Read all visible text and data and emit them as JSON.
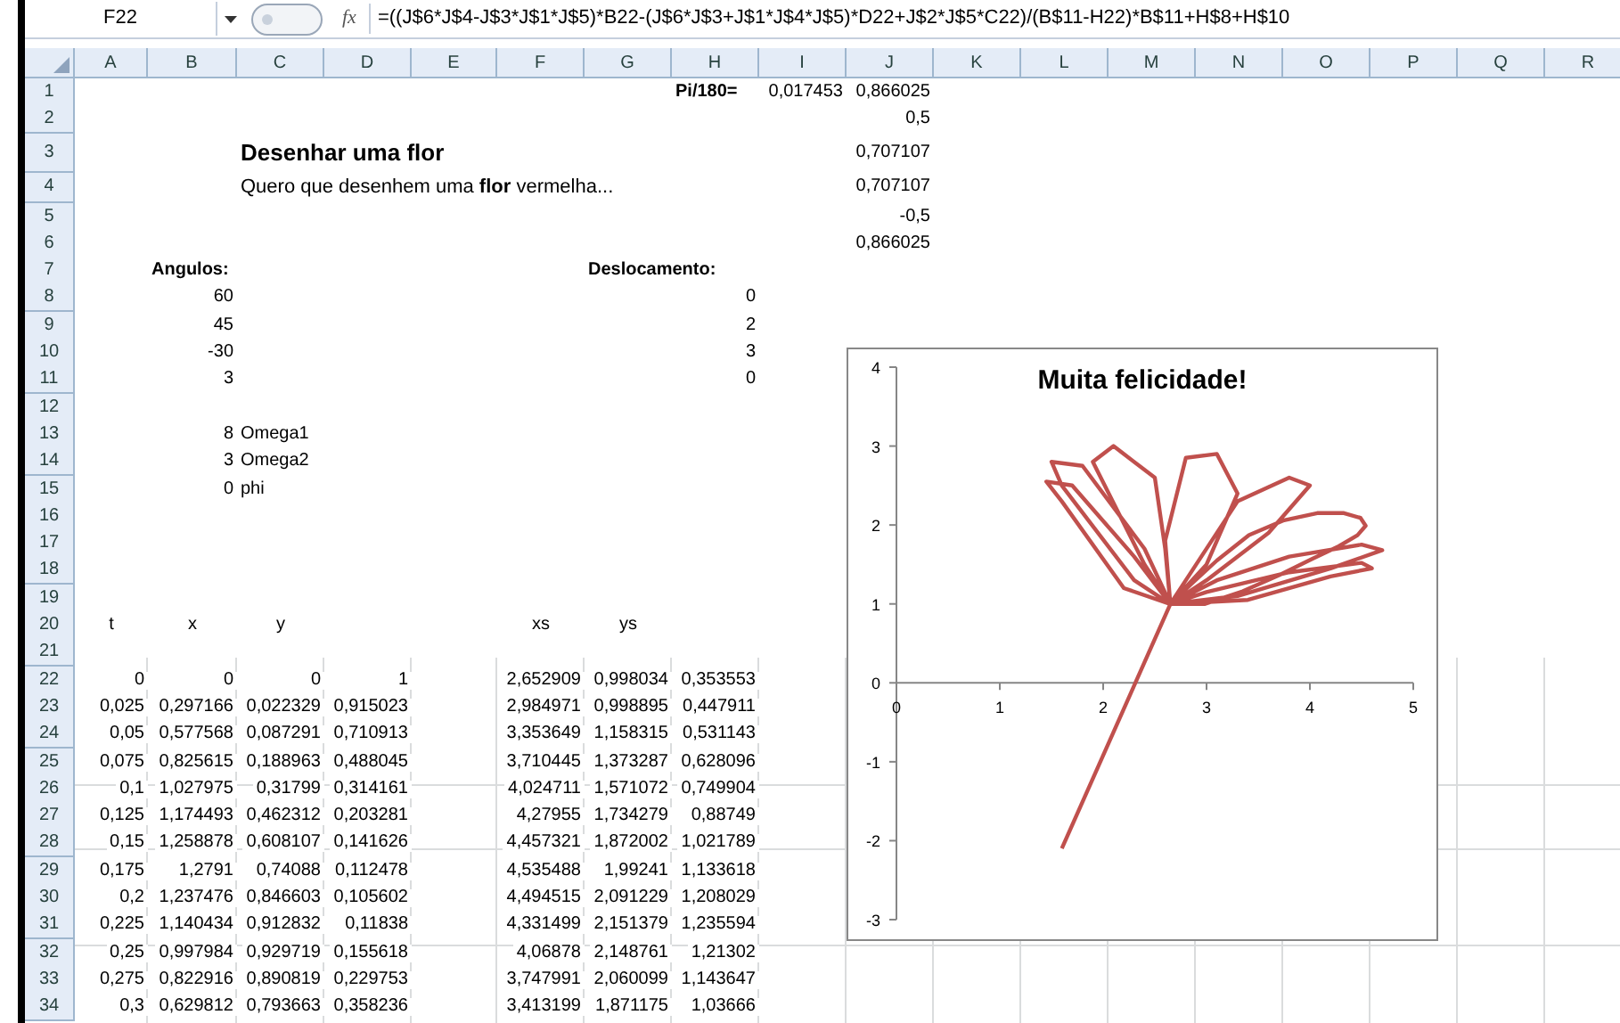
{
  "formula_bar": {
    "name_box": "F22",
    "function_label": "fx",
    "formula": "=((J$6*J$4-J$3*J$1*J$5)*B22-(J$6*J$3+J$1*J$4*J$5)*D22+J$2*J$5*C22)/(B$11-H22)*B$11+H$8+H$10"
  },
  "columns": [
    "A",
    "B",
    "C",
    "D",
    "E",
    "F",
    "G",
    "H",
    "I",
    "J",
    "K",
    "L",
    "M",
    "N",
    "O",
    "P",
    "Q",
    "R"
  ],
  "rows": [
    {
      "number": "1",
      "H": {
        "kind": "label",
        "text": "Pi/180="
      },
      "I": {
        "kind": "number",
        "text": "0,017453"
      },
      "J": {
        "kind": "number",
        "text": "0,866025"
      }
    },
    {
      "number": "2",
      "J": {
        "kind": "number",
        "text": "0,5"
      }
    },
    {
      "number": "3",
      "C": {
        "kind": "title",
        "text": "Desenhar uma flor"
      },
      "J": {
        "kind": "number",
        "text": "0,707107"
      }
    },
    {
      "number": "4",
      "C": {
        "kind": "note",
        "text": "Quero que desenhem uma **flor** vermelha..."
      },
      "J": {
        "kind": "number",
        "text": "0,707107"
      }
    },
    {
      "number": "5",
      "J": {
        "kind": "number",
        "text": "-0,5"
      }
    },
    {
      "number": "6",
      "J": {
        "kind": "number",
        "text": "0,866025"
      }
    },
    {
      "number": "7",
      "B": {
        "kind": "label",
        "text": "Angulos:"
      },
      "G": {
        "kind": "label",
        "text": "Deslocamento:"
      }
    },
    {
      "number": "8",
      "B": {
        "kind": "number",
        "text": "60"
      },
      "H": {
        "kind": "number",
        "text": "0"
      }
    },
    {
      "number": "9",
      "B": {
        "kind": "number",
        "text": "45"
      },
      "H": {
        "kind": "number",
        "text": "2"
      }
    },
    {
      "number": "10",
      "B": {
        "kind": "number",
        "text": "-30"
      },
      "H": {
        "kind": "number",
        "text": "3"
      }
    },
    {
      "number": "11",
      "B": {
        "kind": "number",
        "text": "3"
      },
      "H": {
        "kind": "number",
        "text": "0"
      }
    },
    {
      "number": "12"
    },
    {
      "number": "13",
      "B": {
        "kind": "number",
        "text": "8"
      },
      "C": {
        "kind": "text",
        "text": "Omega1"
      }
    },
    {
      "number": "14",
      "B": {
        "kind": "number",
        "text": "3"
      },
      "C": {
        "kind": "text",
        "text": "Omega2"
      }
    },
    {
      "number": "15",
      "B": {
        "kind": "number",
        "text": "0"
      },
      "C": {
        "kind": "text",
        "text": "phi"
      }
    },
    {
      "number": "16"
    },
    {
      "number": "17"
    },
    {
      "number": "18"
    },
    {
      "number": "19"
    },
    {
      "number": "20",
      "A": {
        "kind": "header",
        "text": "t"
      },
      "B": {
        "kind": "header",
        "text": "x"
      },
      "C": {
        "kind": "header",
        "text": "y"
      },
      "F": {
        "kind": "header",
        "text": "xs"
      },
      "G": {
        "kind": "header",
        "text": "ys"
      }
    },
    {
      "number": "21"
    },
    {
      "number": "22",
      "A": {
        "kind": "number",
        "text": "0"
      },
      "B": {
        "kind": "number",
        "text": "0"
      },
      "C": {
        "kind": "number",
        "text": "0"
      },
      "D": {
        "kind": "number",
        "text": "1"
      },
      "F": {
        "kind": "number",
        "text": "2,652909"
      },
      "G": {
        "kind": "number",
        "text": "0,998034"
      },
      "H": {
        "kind": "number",
        "text": "0,353553"
      }
    },
    {
      "number": "23",
      "A": {
        "kind": "number",
        "text": "0,025"
      },
      "B": {
        "kind": "number",
        "text": "0,297166"
      },
      "C": {
        "kind": "number",
        "text": "0,022329"
      },
      "D": {
        "kind": "number",
        "text": "0,915023"
      },
      "F": {
        "kind": "number",
        "text": "2,984971"
      },
      "G": {
        "kind": "number",
        "text": "0,998895"
      },
      "H": {
        "kind": "number",
        "text": "0,447911"
      }
    },
    {
      "number": "24",
      "A": {
        "kind": "number",
        "text": "0,05"
      },
      "B": {
        "kind": "number",
        "text": "0,577568"
      },
      "C": {
        "kind": "number",
        "text": "0,087291"
      },
      "D": {
        "kind": "number",
        "text": "0,710913"
      },
      "F": {
        "kind": "number",
        "text": "3,353649"
      },
      "G": {
        "kind": "number",
        "text": "1,158315"
      },
      "H": {
        "kind": "number",
        "text": "0,531143"
      }
    },
    {
      "number": "25",
      "A": {
        "kind": "number",
        "text": "0,075"
      },
      "B": {
        "kind": "number",
        "text": "0,825615"
      },
      "C": {
        "kind": "number",
        "text": "0,188963"
      },
      "D": {
        "kind": "number",
        "text": "0,488045"
      },
      "F": {
        "kind": "number",
        "text": "3,710445"
      },
      "G": {
        "kind": "number",
        "text": "1,373287"
      },
      "H": {
        "kind": "number",
        "text": "0,628096"
      }
    },
    {
      "number": "26",
      "A": {
        "kind": "number",
        "text": "0,1"
      },
      "B": {
        "kind": "number",
        "text": "1,027975"
      },
      "C": {
        "kind": "number",
        "text": "0,31799"
      },
      "D": {
        "kind": "number",
        "text": "0,314161"
      },
      "F": {
        "kind": "number",
        "text": "4,024711"
      },
      "G": {
        "kind": "number",
        "text": "1,571072"
      },
      "H": {
        "kind": "number",
        "text": "0,749904"
      }
    },
    {
      "number": "27",
      "A": {
        "kind": "number",
        "text": "0,125"
      },
      "B": {
        "kind": "number",
        "text": "1,174493"
      },
      "C": {
        "kind": "number",
        "text": "0,462312"
      },
      "D": {
        "kind": "number",
        "text": "0,203281"
      },
      "F": {
        "kind": "number",
        "text": "4,27955"
      },
      "G": {
        "kind": "number",
        "text": "1,734279"
      },
      "H": {
        "kind": "number",
        "text": "0,88749"
      }
    },
    {
      "number": "28",
      "A": {
        "kind": "number",
        "text": "0,15"
      },
      "B": {
        "kind": "number",
        "text": "1,258878"
      },
      "C": {
        "kind": "number",
        "text": "0,608107"
      },
      "D": {
        "kind": "number",
        "text": "0,141626"
      },
      "F": {
        "kind": "number",
        "text": "4,457321"
      },
      "G": {
        "kind": "number",
        "text": "1,872002"
      },
      "H": {
        "kind": "number",
        "text": "1,021789"
      }
    },
    {
      "number": "29",
      "A": {
        "kind": "number",
        "text": "0,175"
      },
      "B": {
        "kind": "number",
        "text": "1,2791"
      },
      "C": {
        "kind": "number",
        "text": "0,74088"
      },
      "D": {
        "kind": "number",
        "text": "0,112478"
      },
      "F": {
        "kind": "number",
        "text": "4,535488"
      },
      "G": {
        "kind": "number",
        "text": "1,99241"
      },
      "H": {
        "kind": "number",
        "text": "1,133618"
      }
    },
    {
      "number": "30",
      "A": {
        "kind": "number",
        "text": "0,2"
      },
      "B": {
        "kind": "number",
        "text": "1,237476"
      },
      "C": {
        "kind": "number",
        "text": "0,846603"
      },
      "D": {
        "kind": "number",
        "text": "0,105602"
      },
      "F": {
        "kind": "number",
        "text": "4,494515"
      },
      "G": {
        "kind": "number",
        "text": "2,091229"
      },
      "H": {
        "kind": "number",
        "text": "1,208029"
      }
    },
    {
      "number": "31",
      "A": {
        "kind": "number",
        "text": "0,225"
      },
      "B": {
        "kind": "number",
        "text": "1,140434"
      },
      "C": {
        "kind": "number",
        "text": "0,912832"
      },
      "D": {
        "kind": "number",
        "text": "0,11838"
      },
      "F": {
        "kind": "number",
        "text": "4,331499"
      },
      "G": {
        "kind": "number",
        "text": "2,151379"
      },
      "H": {
        "kind": "number",
        "text": "1,235594"
      }
    },
    {
      "number": "32",
      "A": {
        "kind": "number",
        "text": "0,25"
      },
      "B": {
        "kind": "number",
        "text": "0,997984"
      },
      "C": {
        "kind": "number",
        "text": "0,929719"
      },
      "D": {
        "kind": "number",
        "text": "0,155618"
      },
      "F": {
        "kind": "number",
        "text": "4,06878"
      },
      "G": {
        "kind": "number",
        "text": "2,148761"
      },
      "H": {
        "kind": "number",
        "text": "1,21302"
      }
    },
    {
      "number": "33",
      "A": {
        "kind": "number",
        "text": "0,275"
      },
      "B": {
        "kind": "number",
        "text": "0,822916"
      },
      "C": {
        "kind": "number",
        "text": "0,890819"
      },
      "D": {
        "kind": "number",
        "text": "0,229753"
      },
      "F": {
        "kind": "number",
        "text": "3,747991"
      },
      "G": {
        "kind": "number",
        "text": "2,060099"
      },
      "H": {
        "kind": "number",
        "text": "1,143647"
      }
    },
    {
      "number": "34",
      "A": {
        "kind": "number",
        "text": "0,3"
      },
      "B": {
        "kind": "number",
        "text": "0,629812"
      },
      "C": {
        "kind": "number",
        "text": "0,793663"
      },
      "D": {
        "kind": "number",
        "text": "0,358236"
      },
      "F": {
        "kind": "number",
        "text": "3,413199"
      },
      "G": {
        "kind": "number",
        "text": "1,871175"
      },
      "H": {
        "kind": "number",
        "text": "1,03666"
      }
    }
  ],
  "chart": {
    "chart_data": {
      "type": "line",
      "title": "Muita felicidade!",
      "xlim": [
        0,
        5
      ],
      "ylim": [
        -3,
        4
      ],
      "xticks": [
        {
          "value": 0,
          "label": "0"
        },
        {
          "value": 1,
          "label": "1"
        },
        {
          "value": 2,
          "label": "2"
        },
        {
          "value": 3,
          "label": "3"
        },
        {
          "value": 4,
          "label": "4"
        },
        {
          "value": 5,
          "label": "5"
        }
      ],
      "yticks": [
        {
          "value": -3,
          "label": "-3"
        },
        {
          "value": -2,
          "label": "-2"
        },
        {
          "value": -1,
          "label": "-1"
        },
        {
          "value": 0,
          "label": "0"
        },
        {
          "value": 1,
          "label": "1"
        },
        {
          "value": 2,
          "label": "2"
        },
        {
          "value": 3,
          "label": "3"
        },
        {
          "value": 4,
          "label": "4"
        }
      ],
      "series": [
        {
          "color": "#c0504d",
          "x": [
            1.6,
            2.65,
            2.98,
            3.35,
            3.71,
            4.02,
            4.28,
            4.46,
            4.54,
            4.49,
            4.33,
            4.07,
            3.75,
            3.41,
            3.1,
            2.85,
            2.65,
            3.3,
            4.2,
            4.7,
            4.5,
            3.8,
            3.1,
            2.65,
            2.9,
            3.3,
            3.8,
            4.0,
            3.6,
            3.0,
            2.65,
            2.6,
            2.8,
            3.1,
            3.3,
            3.0,
            2.65,
            2.4,
            1.9,
            2.1,
            2.5,
            2.6,
            2.65,
            2.3,
            1.6,
            1.5,
            1.8,
            2.4,
            2.65,
            2.2,
            1.6,
            1.45,
            1.7,
            2.3,
            2.65,
            3.4,
            4.2,
            4.6,
            4.5,
            3.8,
            3.0,
            2.65
          ],
          "values": [
            -2.1,
            1.0,
            1.0,
            1.16,
            1.37,
            1.57,
            1.73,
            1.87,
            1.99,
            2.09,
            2.15,
            2.15,
            2.06,
            1.87,
            1.55,
            1.25,
            1.0,
            1.1,
            1.45,
            1.68,
            1.75,
            1.6,
            1.3,
            1.0,
            1.5,
            2.3,
            2.6,
            2.5,
            1.9,
            1.3,
            1.0,
            1.8,
            2.85,
            2.9,
            2.4,
            1.5,
            1.0,
            1.5,
            2.8,
            3.0,
            2.6,
            1.7,
            1.0,
            1.3,
            2.5,
            2.8,
            2.75,
            1.7,
            1.0,
            1.2,
            2.3,
            2.55,
            2.5,
            1.6,
            1.0,
            1.05,
            1.35,
            1.45,
            1.52,
            1.4,
            1.15,
            1.0
          ]
        }
      ]
    }
  }
}
